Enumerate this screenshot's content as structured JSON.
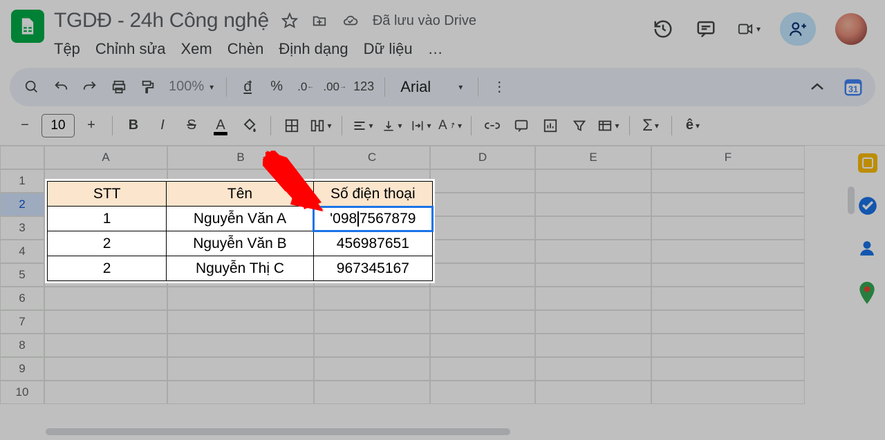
{
  "header": {
    "title": "TGDĐ - 24h Công nghệ",
    "saveStatus": "Đã lưu vào Drive"
  },
  "menu": [
    "Tệp",
    "Chỉnh sửa",
    "Xem",
    "Chèn",
    "Định dạng",
    "Dữ liệu",
    "…"
  ],
  "toolbar": {
    "zoom": "100%",
    "currency": "đ",
    "font": "Arial",
    "fontSize": "10"
  },
  "grid": {
    "cols": [
      "A",
      "B",
      "C",
      "D",
      "E",
      "F"
    ],
    "rows": [
      "1",
      "2",
      "3",
      "4",
      "5",
      "6",
      "7",
      "8",
      "9",
      "10"
    ]
  },
  "table": {
    "headers": [
      "STT",
      "Tên",
      "Số điện thoại"
    ],
    "rows": [
      [
        "1",
        "Nguyễn Văn A",
        "'0987567879"
      ],
      [
        "2",
        "Nguyễn Văn B",
        "456987651"
      ],
      [
        "2",
        "Nguyễn Thị C",
        "967345167"
      ]
    ],
    "editing": {
      "cell": "C2",
      "before": "'098",
      "after": "7567879"
    }
  },
  "colors": {
    "accent": "#1a73e8",
    "headerFill": "#fce5cd",
    "annotation": "#ff0000"
  }
}
